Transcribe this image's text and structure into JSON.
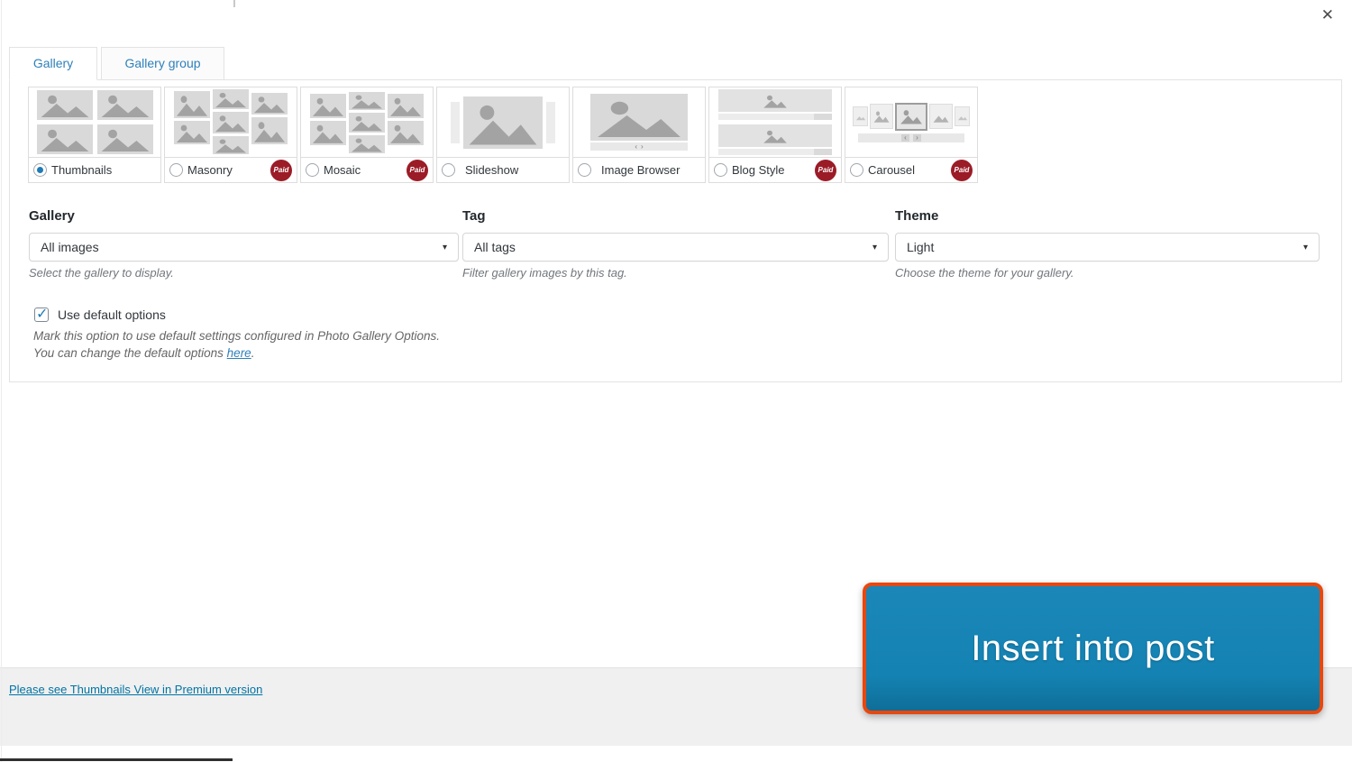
{
  "dialog": {
    "close_icon": "✕"
  },
  "icons": {
    "caret": "▾",
    "check": "✓",
    "prev": "‹",
    "next": "›"
  },
  "labels": {
    "paid": "Paid"
  },
  "tabs": [
    {
      "label": "Gallery",
      "active": true
    },
    {
      "label": "Gallery group",
      "active": false
    }
  ],
  "views": [
    {
      "label": "Thumbnails",
      "selected": true,
      "paid": false
    },
    {
      "label": "Masonry",
      "selected": false,
      "paid": true
    },
    {
      "label": "Mosaic",
      "selected": false,
      "paid": true
    },
    {
      "label": "Slideshow",
      "selected": false,
      "paid": false
    },
    {
      "label": "Image Browser",
      "selected": false,
      "paid": false
    },
    {
      "label": "Blog Style",
      "selected": false,
      "paid": true
    },
    {
      "label": "Carousel",
      "selected": false,
      "paid": true
    }
  ],
  "fields": {
    "gallery": {
      "label": "Gallery",
      "value": "All images",
      "help": "Select the gallery to display."
    },
    "tag": {
      "label": "Tag",
      "value": "All tags",
      "help": "Filter gallery images by this tag."
    },
    "theme": {
      "label": "Theme",
      "value": "Light",
      "help": "Choose the theme for your gallery."
    }
  },
  "defaults": {
    "checkbox_label": "Use default options",
    "checked": true,
    "note_line1": "Mark this option to use default settings configured in Photo Gallery Options.",
    "note_line2_prefix": "You can change the default options ",
    "note_line2_link": "here",
    "note_line2_suffix": "."
  },
  "footer": {
    "premium_link": "Please see Thumbnails View in Premium version",
    "insert_button": "Insert into post"
  },
  "colors": {
    "accent_blue": "#2e80b9",
    "paid_badge": "#9b1c27",
    "button_blue": "#1482b2",
    "button_highlight_border": "#e8470e",
    "link": "#0074a2"
  }
}
